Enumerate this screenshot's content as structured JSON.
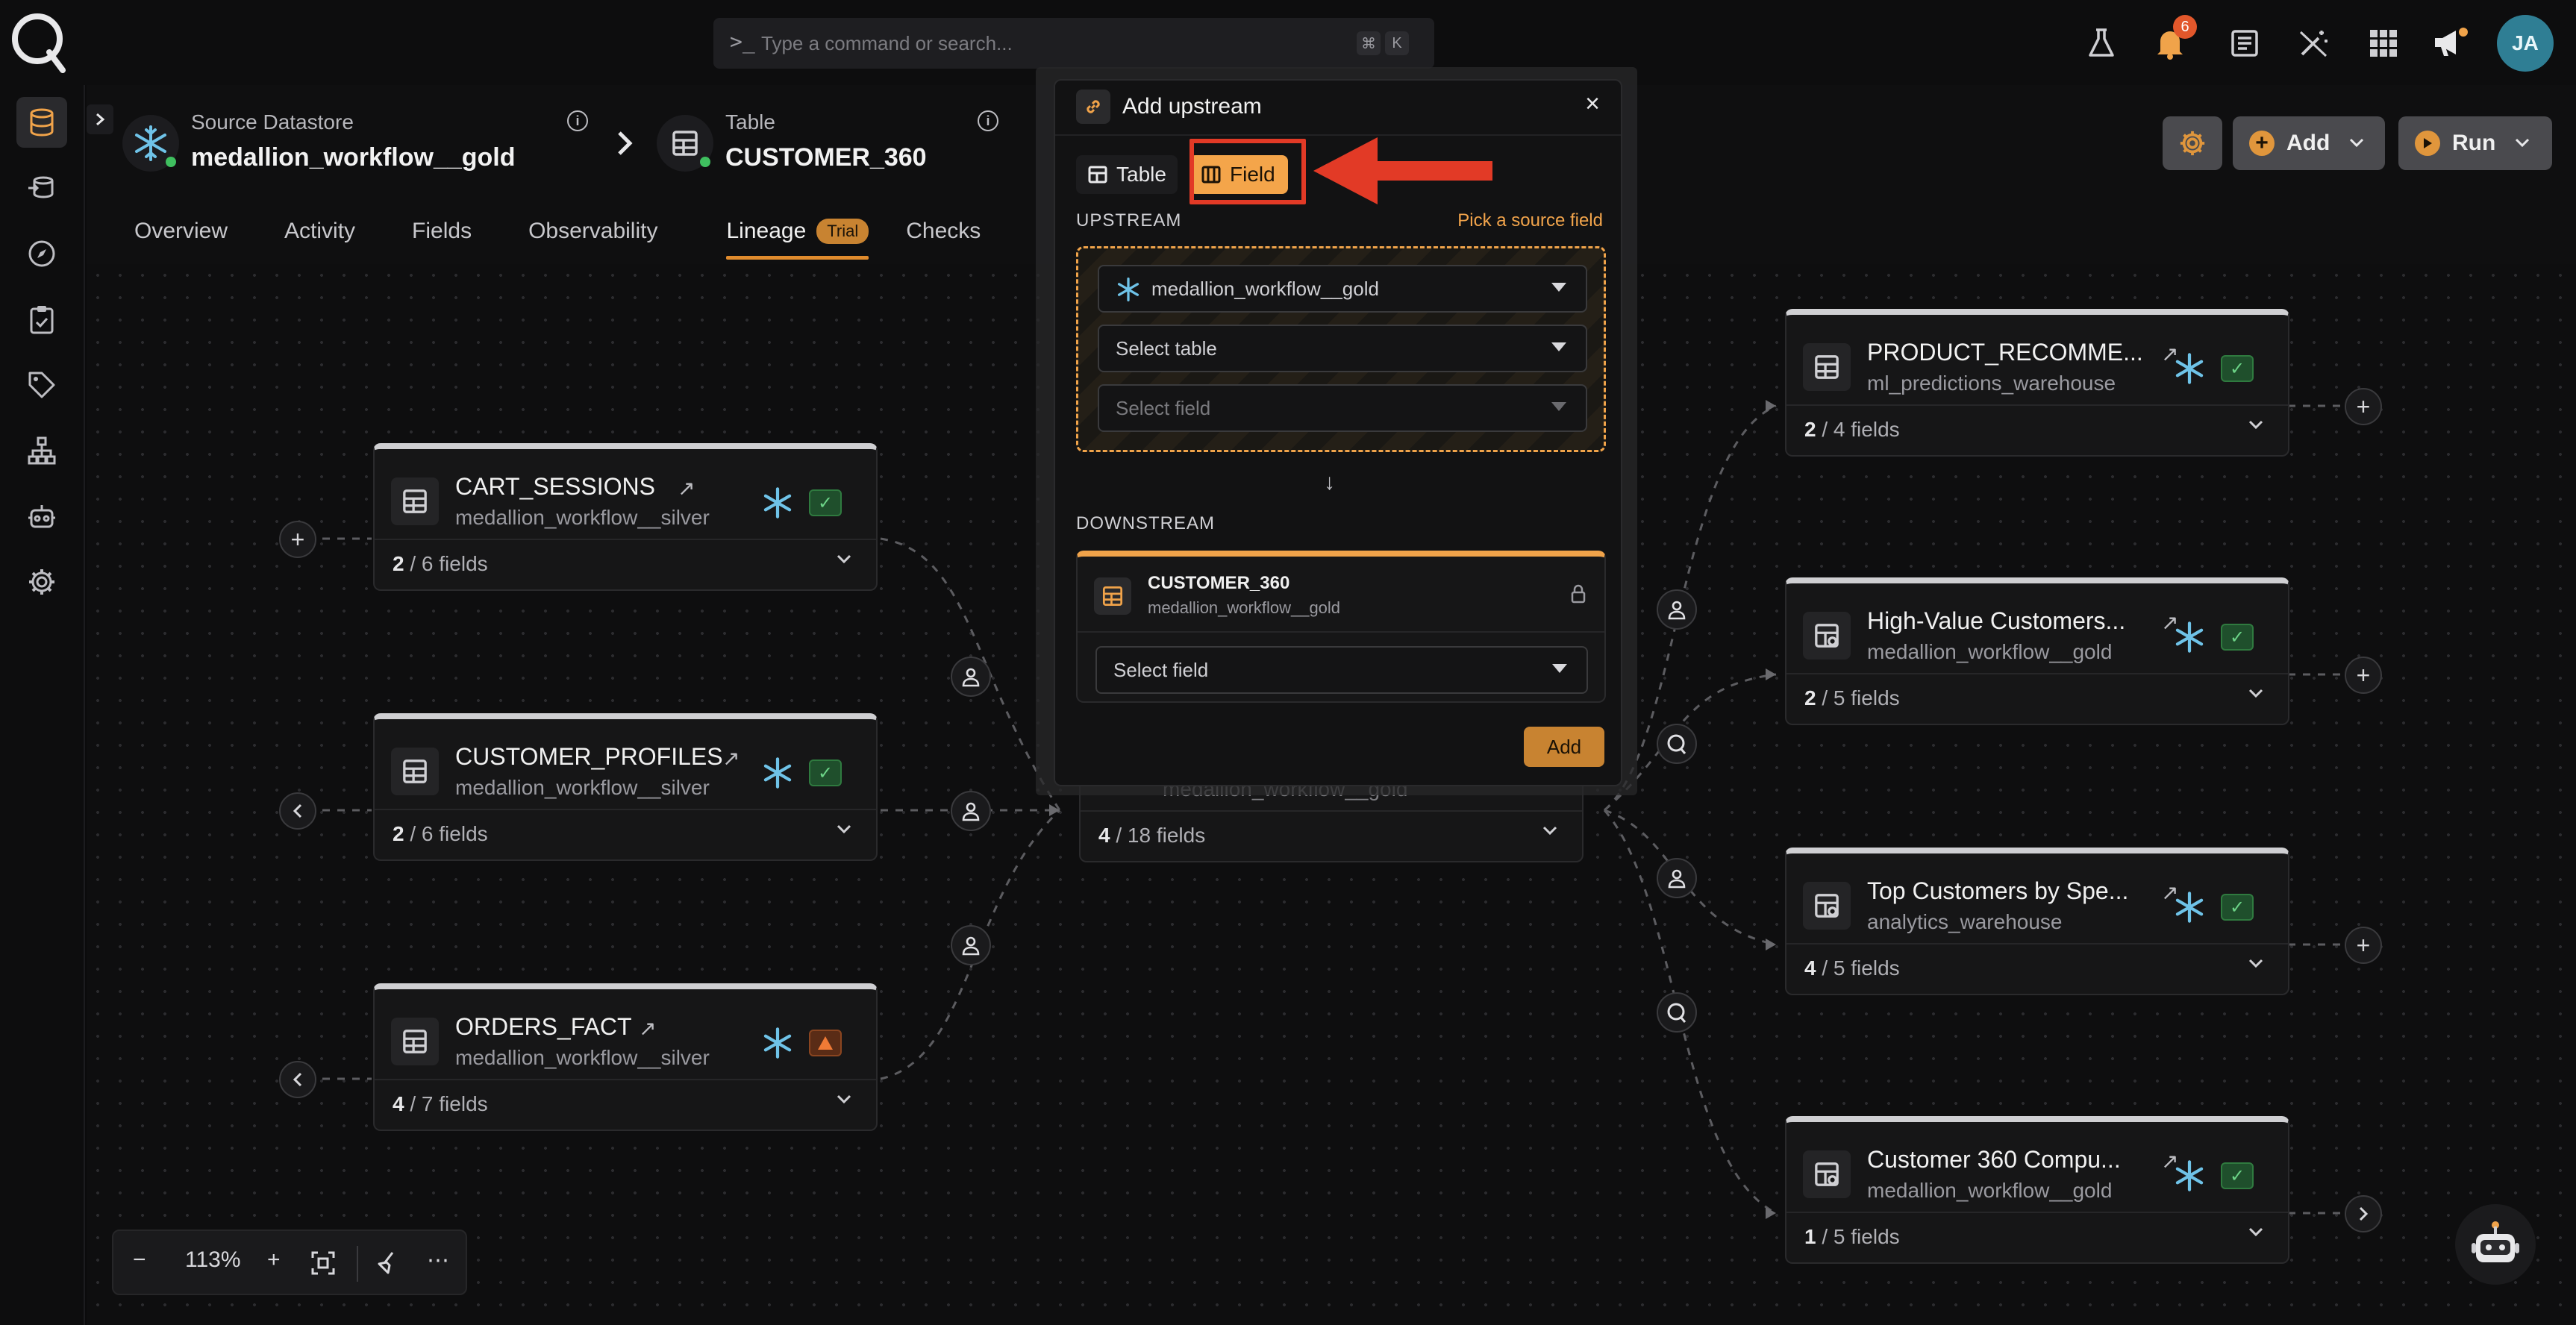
{
  "search": {
    "placeholder": "Type a command or search...",
    "prompt": ">_",
    "kbd1": "⌘",
    "kbd2": "K"
  },
  "topbar": {
    "notifications_count": "6",
    "avatar_initials": "JA"
  },
  "breadcrumb": {
    "source_label": "Source Datastore",
    "source_value": "medallion_workflow__gold",
    "table_label": "Table",
    "table_value": "CUSTOMER_360"
  },
  "tabs": [
    {
      "label": "Overview"
    },
    {
      "label": "Activity"
    },
    {
      "label": "Fields"
    },
    {
      "label": "Observability"
    },
    {
      "label": "Lineage",
      "pill": "Trial"
    },
    {
      "label": "Checks"
    }
  ],
  "actions": {
    "add_label": "Add",
    "run_label": "Run"
  },
  "nodes_left": [
    {
      "name": "CART_SESSIONS",
      "sub": "medallion_workflow__silver",
      "count": "2",
      "total": "/ 6 fields",
      "status": "ok"
    },
    {
      "name": "CUSTOMER_PROFILES",
      "sub": "medallion_workflow__silver",
      "count": "2",
      "total": "/ 6 fields",
      "status": "ok"
    },
    {
      "name": "ORDERS_FACT",
      "sub": "medallion_workflow__silver",
      "count": "4",
      "total": "/ 7 fields",
      "status": "warn"
    }
  ],
  "center_node": {
    "sub": "medallion_workflow__gold",
    "count": "4",
    "total": "/ 18 fields"
  },
  "nodes_right": [
    {
      "name": "PRODUCT_RECOMME...",
      "sub": "ml_predictions_warehouse",
      "count": "2",
      "total": "/ 4 fields"
    },
    {
      "name": "High-Value Customers...",
      "sub": "medallion_workflow__gold",
      "count": "2",
      "total": "/ 5 fields"
    },
    {
      "name": "Top Customers by Spe...",
      "sub": "analytics_warehouse",
      "count": "4",
      "total": "/ 5 fields"
    },
    {
      "name": "Customer 360 Compu...",
      "sub": "medallion_workflow__gold",
      "count": "1",
      "total": "/ 5 fields"
    }
  ],
  "zoom": {
    "level": "113%",
    "minus": "−",
    "plus": "+"
  },
  "modal": {
    "title": "Add upstream",
    "close": "×",
    "seg_table": "Table",
    "seg_field": "Field",
    "upstream_label": "UPSTREAM",
    "upstream_hint": "Pick a source field",
    "datastore_value": "medallion_workflow__gold",
    "table_placeholder": "Select table",
    "field_placeholder": "Select field",
    "down_arrow": "↓",
    "downstream_label": "DOWNSTREAM",
    "downstream_name": "CUSTOMER_360",
    "downstream_sub": "medallion_workflow__gold",
    "downstream_field_placeholder": "Select field",
    "add_label": "Add"
  },
  "colors": {
    "accent": "#f4a54a",
    "annotation": "#e23a26",
    "ok": "#6cd487"
  }
}
